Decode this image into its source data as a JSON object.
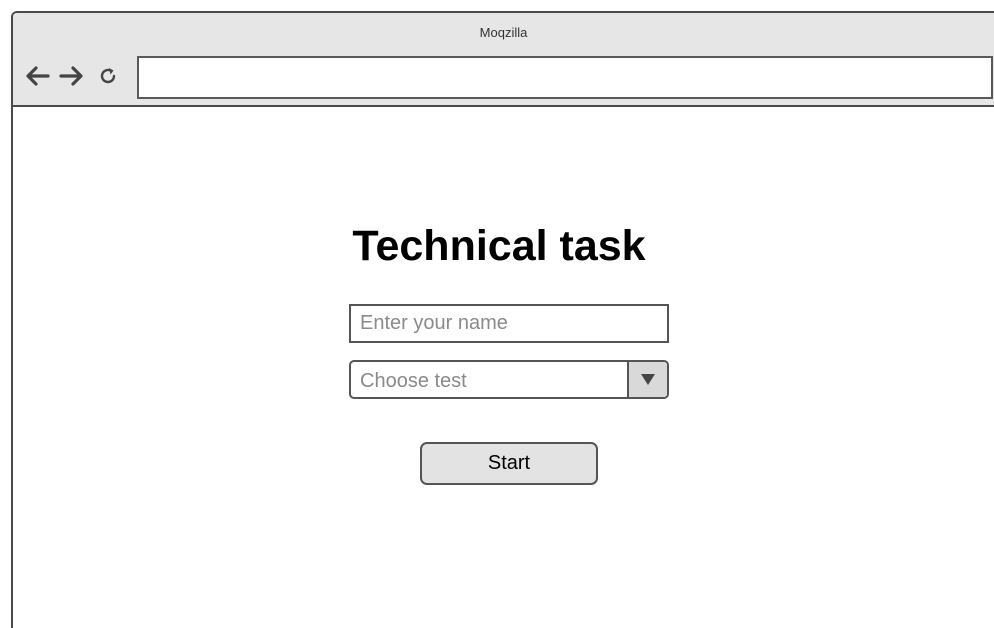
{
  "window": {
    "title": "Moqzilla"
  },
  "toolbar": {
    "back_icon": "arrow-left-icon",
    "forward_icon": "arrow-right-icon",
    "reload_icon": "reload-icon",
    "address_value": ""
  },
  "page": {
    "title": "Technical task",
    "name_input": {
      "placeholder": "Enter your name",
      "value": ""
    },
    "test_select": {
      "selected": "Choose test",
      "arrow_icon": "triangle-down-icon"
    },
    "start_button": {
      "label": "Start"
    }
  },
  "colors": {
    "chrome_bg": "#e6e6e6",
    "border": "#4a4a4a",
    "button_bg": "#e3e3e3",
    "placeholder": "#8a8a8a"
  }
}
